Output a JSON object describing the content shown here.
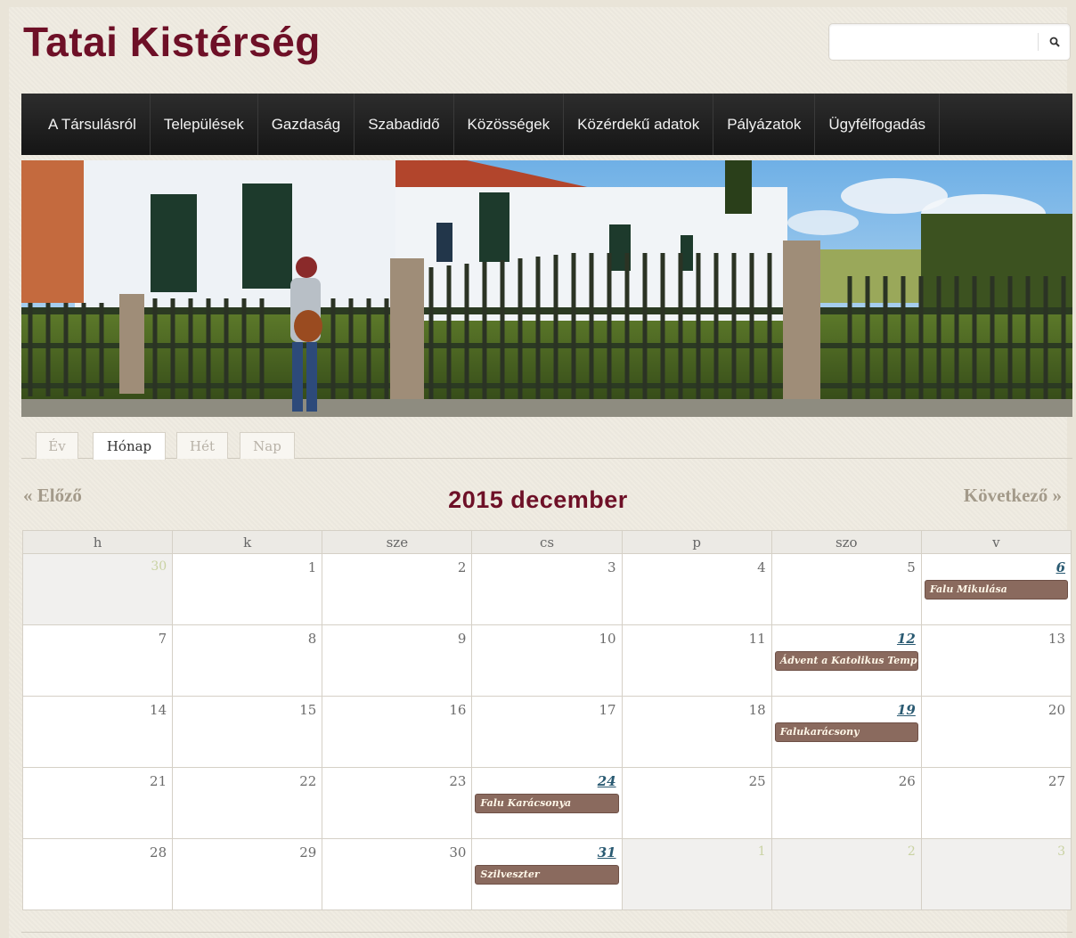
{
  "header": {
    "site_title": "Tatai Kistérség",
    "search": {
      "placeholder": "",
      "value": "",
      "icon": "search-icon"
    }
  },
  "nav": {
    "items": [
      "A Társulásról",
      "Települések",
      "Gazdaság",
      "Szabadidő",
      "Közösségek",
      "Közérdekű adatok",
      "Pályázatok",
      "Ügyfélfogadás"
    ]
  },
  "view_tabs": {
    "items": [
      "Év",
      "Hónap",
      "Hét",
      "Nap"
    ],
    "active": "Hónap"
  },
  "calendar": {
    "prev_label": "« Előző",
    "next_label": "Következő »",
    "title": "2015 december",
    "weekdays": [
      "h",
      "k",
      "sze",
      "cs",
      "p",
      "szo",
      "v"
    ],
    "weeks": [
      [
        {
          "day": "30",
          "other": true
        },
        {
          "day": "1"
        },
        {
          "day": "2"
        },
        {
          "day": "3"
        },
        {
          "day": "4"
        },
        {
          "day": "5"
        },
        {
          "day": "6",
          "link": true,
          "event": "Falu Mikulása"
        }
      ],
      [
        {
          "day": "7"
        },
        {
          "day": "8"
        },
        {
          "day": "9"
        },
        {
          "day": "10"
        },
        {
          "day": "11"
        },
        {
          "day": "12",
          "link": true,
          "event": "Ádvent a Katolikus Templomban"
        },
        {
          "day": "13"
        }
      ],
      [
        {
          "day": "14"
        },
        {
          "day": "15"
        },
        {
          "day": "16"
        },
        {
          "day": "17"
        },
        {
          "day": "18"
        },
        {
          "day": "19",
          "link": true,
          "event": "Falukarácsony"
        },
        {
          "day": "20"
        }
      ],
      [
        {
          "day": "21"
        },
        {
          "day": "22"
        },
        {
          "day": "23"
        },
        {
          "day": "24",
          "link": true,
          "event": "Falu Karácsonya"
        },
        {
          "day": "25"
        },
        {
          "day": "26"
        },
        {
          "day": "27"
        }
      ],
      [
        {
          "day": "28"
        },
        {
          "day": "29"
        },
        {
          "day": "30"
        },
        {
          "day": "31",
          "link": true,
          "event": "Szilveszter"
        },
        {
          "day": "1",
          "other": true
        },
        {
          "day": "2",
          "other": true
        },
        {
          "day": "3",
          "other": true
        }
      ]
    ]
  },
  "colors": {
    "title": "#6e1027",
    "nav_bg": "#1f1f1f",
    "event_bg": "#8a6a5e",
    "link_day": "#2a5a72"
  }
}
